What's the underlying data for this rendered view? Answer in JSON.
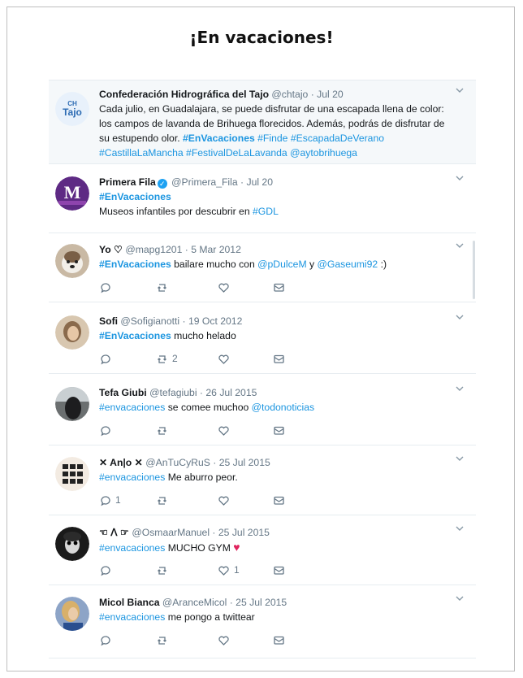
{
  "page": {
    "title": "¡En vacaciones!"
  },
  "tweets": [
    {
      "name": "Confederación Hidrográfica del Tajo",
      "handle": "@chtajo",
      "date": "Jul 20",
      "avatar_text": "CH\nTajo",
      "lines": [
        [
          {
            "t": "Cada julio, en Guadalajara, se puede disfrutar de una escapada llena de color:"
          }
        ],
        [
          {
            "t": "los campos de lavanda de Brihuega florecidos. Además, podrás de disfrutar de"
          }
        ],
        [
          {
            "t": "su estupendo olor.  "
          },
          {
            "t": "#EnVacaciones",
            "c": "tag b"
          },
          {
            "t": " "
          },
          {
            "t": "#Finde",
            "c": "tag"
          },
          {
            "t": " "
          },
          {
            "t": "#EscapadaDeVerano",
            "c": "tag"
          }
        ],
        [
          {
            "t": "#CastillaLaMancha",
            "c": "tag"
          },
          {
            "t": " "
          },
          {
            "t": "#FestivalDeLaLavanda",
            "c": "tag"
          },
          {
            "t": " "
          },
          {
            "t": "@aytobrihuega",
            "c": "tag"
          }
        ]
      ]
    },
    {
      "name": "Primera Fila",
      "handle": "@Primera_Fila",
      "date": "Jul 20",
      "avatar_text": "M",
      "avatar_sub": "PRIMERA FILA",
      "lines": [
        [
          {
            "t": "#EnVacaciones",
            "c": "tag b"
          }
        ],
        [
          {
            "t": "Museos infantiles por descubrir en "
          },
          {
            "t": "#GDL",
            "c": "tag"
          }
        ]
      ]
    },
    {
      "name": "Yo ♡",
      "handle": "@mapg1201",
      "date": "5 Mar 2012",
      "lines": [
        [
          {
            "t": "#EnVacaciones",
            "c": "tag b"
          },
          {
            "t": " bailare mucho con "
          },
          {
            "t": "@pDulceM",
            "c": "tag"
          },
          {
            "t": " y "
          },
          {
            "t": "@Gaseumi92",
            "c": "tag"
          },
          {
            "t": " :)"
          }
        ]
      ]
    },
    {
      "name": "Sofi",
      "handle": "@Sofigianotti",
      "date": "19 Oct 2012",
      "retweets": "2",
      "lines": [
        [
          {
            "t": "#EnVacaciones",
            "c": "tag b"
          },
          {
            "t": " mucho helado"
          }
        ]
      ]
    },
    {
      "name": "Tefa Giubi",
      "handle": "@tefagiubi",
      "date": "26 Jul 2015",
      "lines": [
        [
          {
            "t": "#envacaciones",
            "c": "tag"
          },
          {
            "t": "  se comee muchoo "
          },
          {
            "t": "@todonoticias",
            "c": "tag"
          }
        ]
      ]
    },
    {
      "name": "✕ An|o ✕",
      "handle": "@AnTuCyRuS",
      "date": "25 Jul 2015",
      "replies": "1",
      "lines": [
        [
          {
            "t": "#envacaciones",
            "c": "tag"
          },
          {
            "t": " Me aburro peor."
          }
        ]
      ]
    },
    {
      "name": "☜ ᐱ ☞",
      "handle": "@OsmaarManuel",
      "date": "25 Jul 2015",
      "likes": "1",
      "lines": [
        [
          {
            "t": "#envacaciones",
            "c": "tag"
          },
          {
            "t": " MUCHO GYM "
          },
          {
            "t": "♥",
            "c": "heart"
          }
        ]
      ]
    },
    {
      "name": "Micol Bianca",
      "handle": "@AranceMicol",
      "date": "25 Jul 2015",
      "lines": [
        [
          {
            "t": "#envacaciones",
            "c": "tag"
          },
          {
            "t": " me pongo a twittear"
          }
        ]
      ]
    }
  ],
  "colors": {
    "link": "#1b95e0",
    "muted": "#657786",
    "heart": "#e0245e"
  }
}
